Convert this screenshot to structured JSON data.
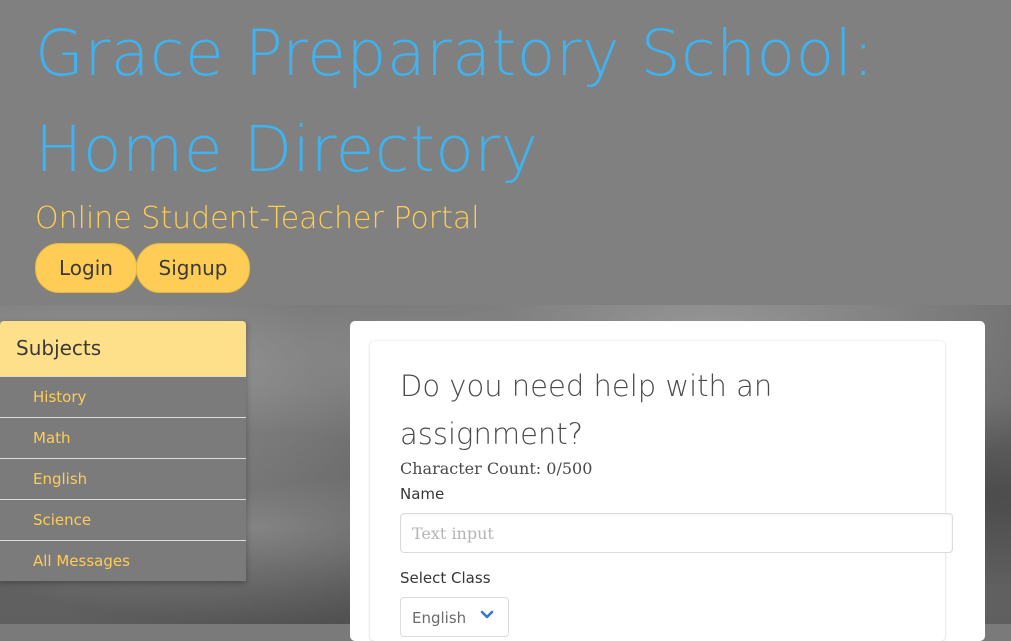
{
  "header": {
    "title": "Grace Preparatory School: Home Directory",
    "subtitle": "Online Student-Teacher Portal",
    "login_label": "Login",
    "signup_label": "Signup"
  },
  "sidebar": {
    "heading": "Subjects",
    "items": [
      {
        "label": "History"
      },
      {
        "label": "Math"
      },
      {
        "label": "English"
      },
      {
        "label": "Science"
      },
      {
        "label": "All Messages"
      }
    ]
  },
  "form": {
    "title": "Do you need help with an assignment?",
    "char_count": "Character Count: 0/500",
    "name_label": "Name",
    "name_placeholder": "Text input",
    "class_label": "Select Class",
    "class_value": "English"
  },
  "colors": {
    "title": "#3fb2f0",
    "accent": "#ffcd55",
    "menu_heading": "#ffe08a",
    "chevron": "#3273dc"
  }
}
